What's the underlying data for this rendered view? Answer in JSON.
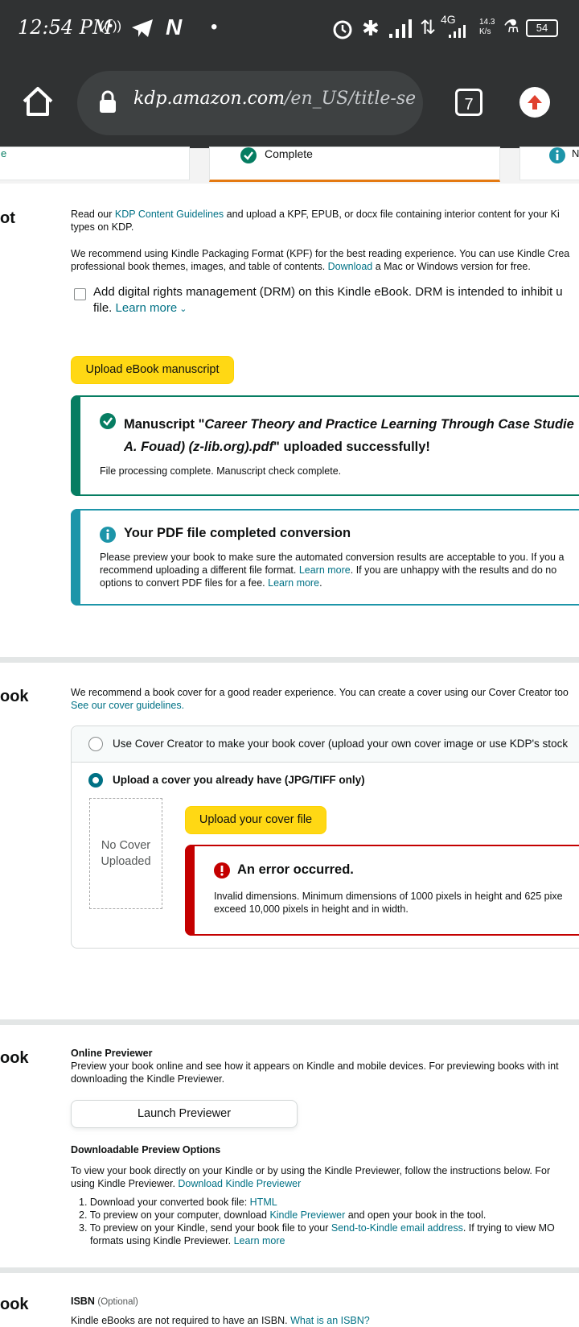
{
  "status_bar": {
    "time": "12:54 PM",
    "network": "4G",
    "speed": "14.3 K/s",
    "battery": "54"
  },
  "browser": {
    "url_host": "kdp.amazon.com",
    "url_path": "/en_US/title-setup/kin",
    "tab_count": "7"
  },
  "tabs": {
    "left_fragment": "e",
    "middle_label": "Complete",
    "right_fragment": "N"
  },
  "manuscript": {
    "section_fragment": "ot",
    "intro_pre": "Read our ",
    "intro_link": "KDP Content Guidelines",
    "intro_post": " and upload a KPF, EPUB, or docx file containing interior content for your Ki",
    "intro_line2": "types on KDP.",
    "rec_line1": "We recommend using Kindle Packaging Format (KPF) for the best reading experience. You can use Kindle Crea",
    "rec_line2_pre": "professional book themes, images, and table of contents. ",
    "rec_link": "Download",
    "rec_line2_post": " a Mac or Windows version for free.",
    "drm_line1": "Add digital rights management (DRM) on this Kindle eBook. DRM is intended to inhibit u",
    "drm_line2_pre": "file. ",
    "drm_link": "Learn more",
    "upload_button": "Upload eBook manuscript",
    "success": {
      "line1_pre": "Manuscript \"",
      "line1_italic": "Career Theory and Practice Learning Through Case Studie",
      "line2_italic": "A. Fouad) (z-lib.org).pdf",
      "line2_post": "\" uploaded successfully!",
      "body": "File processing complete. Manuscript check complete."
    },
    "conversion": {
      "title": "Your PDF file completed conversion",
      "line1": "Please preview your book to make sure the automated conversion results are acceptable to you. If you a",
      "line2_pre": "recommend uploading a different file format. ",
      "line2_link": "Learn more",
      "line2_post": ". If you are unhappy with the results and do no",
      "line3_pre": "options to convert PDF files for a fee. ",
      "line3_link": "Learn more",
      "line3_post": "."
    }
  },
  "cover": {
    "section_fragment": "ook",
    "intro_line1": "We recommend a book cover for a good reader experience. You can create a cover using our Cover Creator too",
    "guidelines_link": "See our cover guidelines.",
    "option_creator": "Use Cover Creator to make your book cover (upload your own cover image or use KDP's stock",
    "option_upload": "Upload a cover you already have (JPG/TIFF only)",
    "placeholder_line1": "No Cover",
    "placeholder_line2": "Uploaded",
    "upload_button": "Upload your cover file",
    "error": {
      "title": "An error occurred.",
      "line1": "Invalid dimensions. Minimum dimensions of 1000 pixels in height and 625 pixe",
      "line2": "exceed 10,000 pixels in height and in width."
    }
  },
  "preview": {
    "section_fragment": "ook",
    "online_heading": "Online Previewer",
    "online_line1": "Preview your book online and see how it appears on Kindle and mobile devices. For previewing books with int",
    "online_line2": "downloading the Kindle Previewer.",
    "launch_button": "Launch Previewer",
    "download_heading": "Downloadable Preview Options",
    "download_line1": "To view your book directly on your Kindle or by using the Kindle Previewer, follow the instructions below. For",
    "download_line2_pre": "using Kindle Previewer. ",
    "download_link": "Download Kindle Previewer",
    "steps": [
      {
        "num": "1.",
        "pre": "Download your converted book file: ",
        "link": "HTML",
        "post": ""
      },
      {
        "num": "2.",
        "pre": "To preview on your computer, download ",
        "link": "Kindle Previewer",
        "post": " and open your book in the tool."
      },
      {
        "num": "3.",
        "pre": "To preview on your Kindle, send your book file to your ",
        "link": "Send-to-Kindle email address",
        "post": ". If trying to view MO"
      }
    ],
    "step3_line2_pre": "formats using Kindle Previewer. ",
    "step3_link2": "Learn more"
  },
  "isbn": {
    "section_fragment": "ook",
    "label": "ISBN",
    "optional": "(Optional)",
    "line1_pre": "Kindle eBooks are not required to have an ISBN. ",
    "line1_link": "What is an ISBN?"
  },
  "colors": {
    "accent_yellow": "#ffd814",
    "link_teal": "#007185",
    "success_green": "#067d62",
    "info_teal": "#1d95a9",
    "error_red": "#c40000",
    "tab_underline": "#e47911"
  }
}
